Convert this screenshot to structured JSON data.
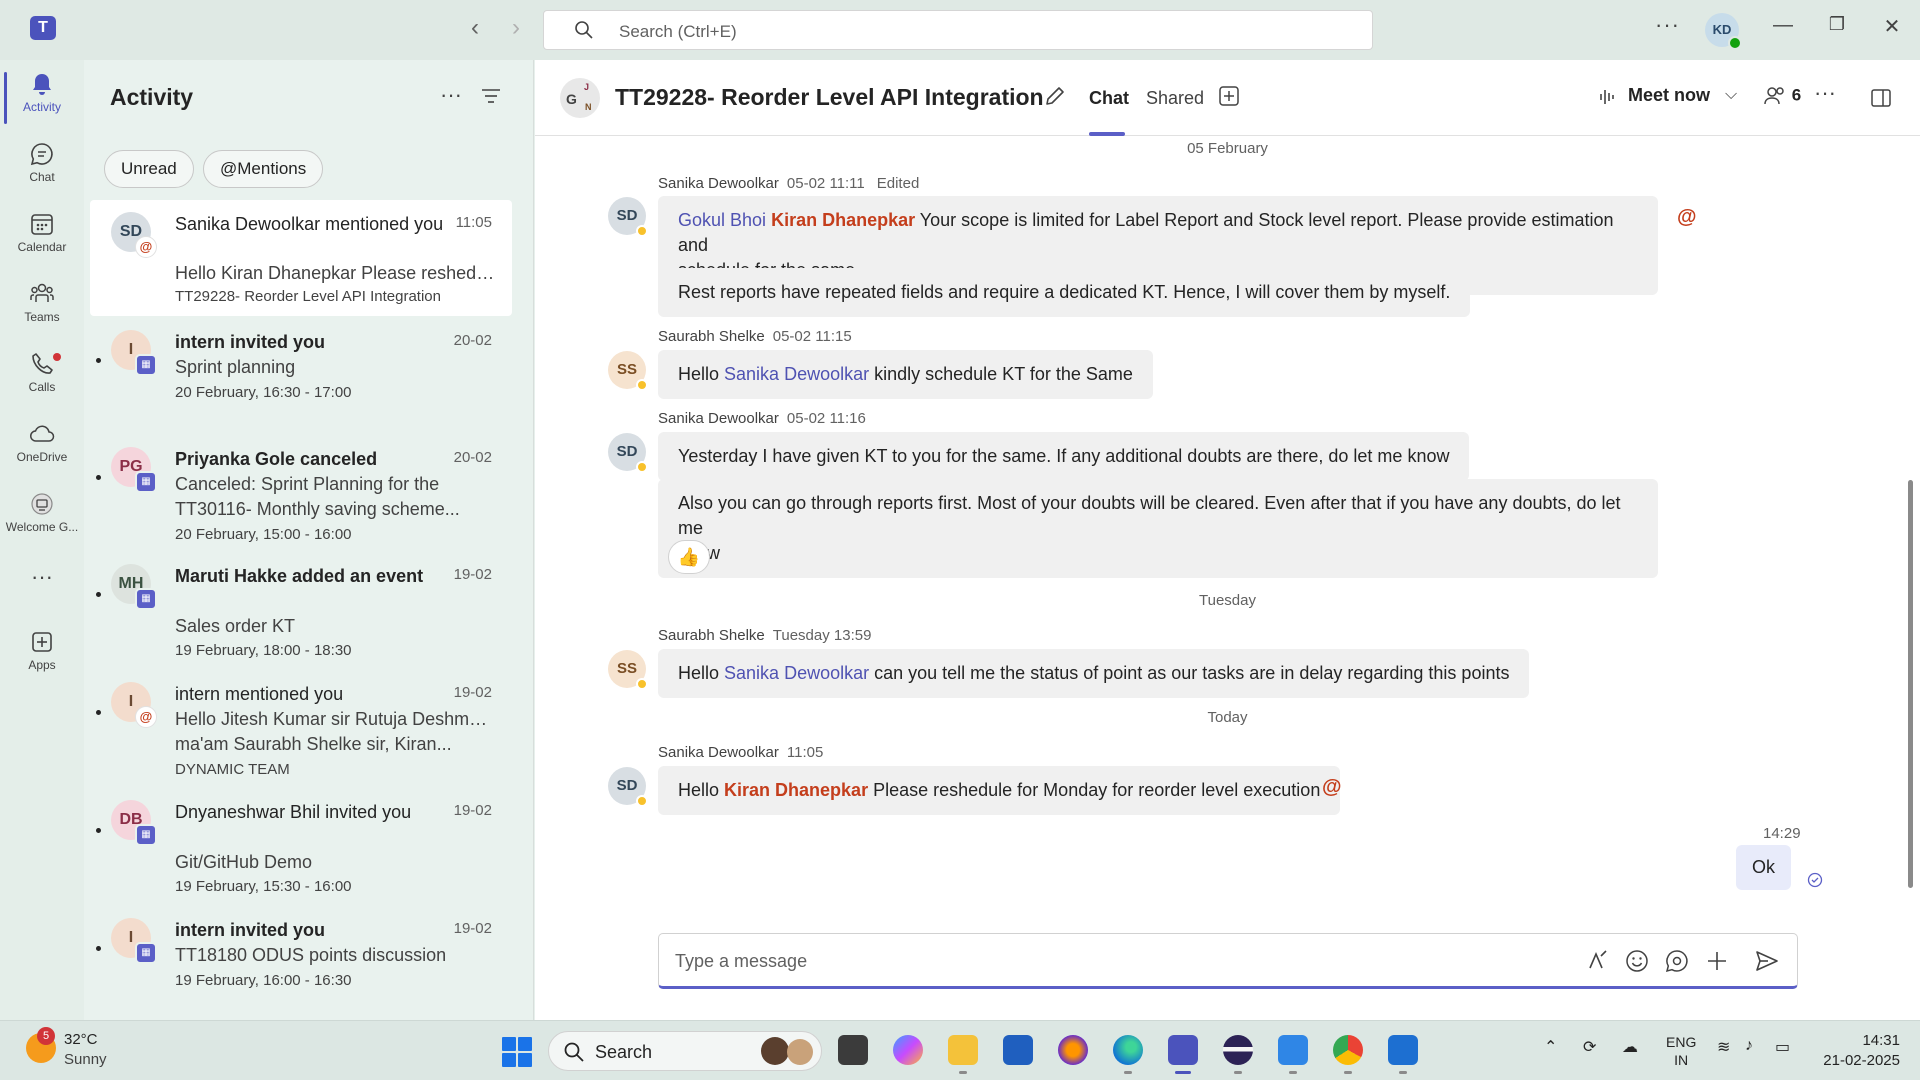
{
  "app": {
    "logo": "T",
    "search_placeholder": "Search (Ctrl+E)",
    "user_initials": "KD",
    "nav_back": "‹",
    "nav_forward": "›",
    "more": "···",
    "min": "—",
    "restore": "❐",
    "close": "✕"
  },
  "rail": {
    "items": [
      {
        "label": "Activity",
        "icon": "bell-icon"
      },
      {
        "label": "Chat",
        "icon": "chat-icon"
      },
      {
        "label": "Calendar",
        "icon": "calendar-icon"
      },
      {
        "label": "Teams",
        "icon": "teams-icon"
      },
      {
        "label": "Calls",
        "icon": "phone-icon"
      },
      {
        "label": "OneDrive",
        "icon": "cloud-icon"
      },
      {
        "label": "Welcome G...",
        "icon": "welcome-icon"
      },
      {
        "label": "···",
        "icon": "more-icon"
      },
      {
        "label": "Apps",
        "icon": "add-app-icon"
      }
    ]
  },
  "activity": {
    "title": "Activity",
    "more": "···",
    "filters": [
      "Unread",
      "@Mentions"
    ],
    "items": [
      {
        "initials": "SD",
        "badge": "@",
        "title": "Sanika Dewoolkar mentioned you",
        "time": "11:05",
        "line1": "Hello Kiran Dhanepkar Please reshedul...",
        "line2": "",
        "sub": "TT29228- Reorder Level API Integration"
      },
      {
        "initials": "I",
        "badge": "cal",
        "title": "intern invited you",
        "time": "20-02",
        "line1": "Sprint planning",
        "line2": "",
        "sub": "20 February, 16:30 - 17:00"
      },
      {
        "initials": "PG",
        "badge": "cal",
        "title": "Priyanka Gole canceled",
        "time": "20-02",
        "line1": "Canceled: Sprint Planning for the",
        "line2": "TT30116- Monthly saving scheme...",
        "sub": "20 February, 15:00 - 16:00"
      },
      {
        "initials": "MH",
        "badge": "cal",
        "title": "Maruti Hakke added an event",
        "time": "19-02",
        "line1": "Sales order KT",
        "line2": "",
        "sub": "19 February, 18:00 - 18:30"
      },
      {
        "initials": "I",
        "badge": "@",
        "title": "intern mentioned you",
        "time": "19-02",
        "line1": "Hello Jitesh Kumar sir Rutuja Deshmukh",
        "line2": "ma'am Saurabh Shelke sir, Kiran...",
        "sub": "DYNAMIC TEAM"
      },
      {
        "initials": "DB",
        "badge": "cal",
        "title": "Dnyaneshwar Bhil invited you",
        "time": "19-02",
        "line1": "Git/GitHub Demo",
        "line2": "",
        "sub": "19 February, 15:30 - 16:00"
      },
      {
        "initials": "I",
        "badge": "cal",
        "title": "intern invited you",
        "time": "19-02",
        "line1": "TT18180 ODUS points discussion",
        "line2": "",
        "sub": "19 February, 16:00 - 16:30"
      }
    ]
  },
  "chat": {
    "group_initials": [
      "G",
      "J",
      "N"
    ],
    "title": "TT29228- Reorder Level API Integration",
    "tabs": [
      "Chat",
      "Shared"
    ],
    "meet_now": "Meet now",
    "participants": "6",
    "more": "···",
    "date_feb": "05 February",
    "date_tue": "Tuesday",
    "date_today": "Today",
    "m1": {
      "author": "Sanika Dewoolkar",
      "time": "05-02 11:11",
      "edited": "Edited",
      "initials": "SD",
      "mention1": "Gokul Bhoi",
      "mention2": "Kiran Dhanepkar",
      "text1": " Your scope is limited for Label Report and Stock level report. Please provide estimation and",
      "text1b": "schedule for the same.",
      "text2": "Rest reports have repeated fields and require a dedicated KT. Hence, I will cover them by myself."
    },
    "m2": {
      "author": "Saurabh Shelke",
      "time": "05-02 11:15",
      "initials": "SS",
      "pre": "Hello ",
      "mention": "Sanika Dewoolkar",
      "post": " kindly schedule KT for the Same"
    },
    "m3": {
      "author": "Sanika Dewoolkar",
      "time": "05-02 11:16",
      "initials": "SD",
      "text1": "Yesterday I have given KT to you for the same. If any additional doubts are there, do let me know",
      "text2": "Also you can go through reports first. Most of your doubts will be cleared. Even after that if you have any doubts, do let me",
      "text2b": "know",
      "reaction": "👍"
    },
    "m4": {
      "author": "Saurabh Shelke",
      "time": "Tuesday 13:59",
      "initials": "SS",
      "pre": "Hello ",
      "mention": "Sanika Dewoolkar",
      "post": " can you tell me the status of point as our tasks are in delay regarding this points"
    },
    "m5": {
      "author": "Sanika Dewoolkar",
      "time": "11:05",
      "initials": "SD",
      "pre": "Hello ",
      "mention": "Kiran Dhanepkar",
      "post": " Please reshedule for Monday for reorder level execution"
    },
    "mine": {
      "time": "14:29",
      "text": "Ok"
    },
    "compose_placeholder": "Type a message",
    "at": "@"
  },
  "taskbar": {
    "weather_temp": "32°C",
    "weather_cond": "Sunny",
    "weather_badge": "5",
    "search": "Search",
    "lang1": "ENG",
    "lang2": "IN",
    "time": "14:31",
    "date": "21-02-2025"
  },
  "colors": {
    "accent": "#5b5fc7",
    "mention_me": "#c43e1c",
    "mention": "#4f52b2"
  }
}
